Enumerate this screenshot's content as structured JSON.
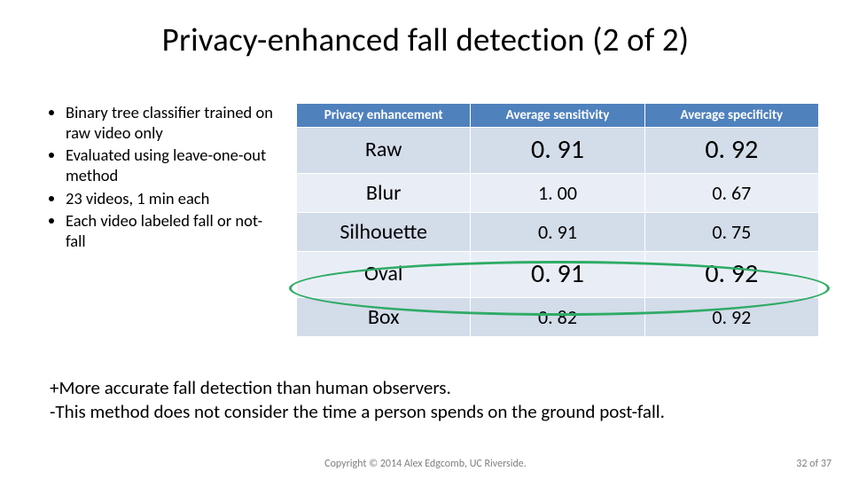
{
  "title": "Privacy-enhanced fall detection (2 of 2)",
  "bullets": [
    "Binary tree classifier trained on raw video only",
    "Evaluated using leave-one-out method",
    "23 videos, 1 min each",
    "Each video labeled fall or not-fall"
  ],
  "table": {
    "headers": [
      "Privacy enhancement",
      "Average sensitivity",
      "Average specificity"
    ],
    "rows": [
      {
        "cells": [
          "Raw",
          "0. 91",
          "0. 92"
        ],
        "big": true
      },
      {
        "cells": [
          "Blur",
          "1. 00",
          "0. 67"
        ],
        "big": false
      },
      {
        "cells": [
          "Silhouette",
          "0. 91",
          "0. 75"
        ],
        "big": false
      },
      {
        "cells": [
          "Oval",
          "0. 91",
          "0. 92"
        ],
        "big": true
      },
      {
        "cells": [
          "Box",
          "0. 82",
          "0. 92"
        ],
        "big": false
      }
    ]
  },
  "notes": {
    "line1": "+More accurate fall detection than human observers.",
    "line2": "-This method does not consider the time a person spends on the ground post-fall."
  },
  "copyright": "Copyright © 2014 Alex Edgcomb, UC Riverside.",
  "page": {
    "current": "32",
    "sep": " of ",
    "total": "37"
  },
  "chart_data": {
    "type": "table",
    "title": "Privacy-enhanced fall detection (2 of 2)",
    "columns": [
      "Privacy enhancement",
      "Average sensitivity",
      "Average specificity"
    ],
    "rows": [
      [
        "Raw",
        0.91,
        0.92
      ],
      [
        "Blur",
        1.0,
        0.67
      ],
      [
        "Silhouette",
        0.91,
        0.75
      ],
      [
        "Oval",
        0.91,
        0.92
      ],
      [
        "Box",
        0.82,
        0.92
      ]
    ],
    "highlighted_rows": [
      "Raw",
      "Oval"
    ]
  }
}
